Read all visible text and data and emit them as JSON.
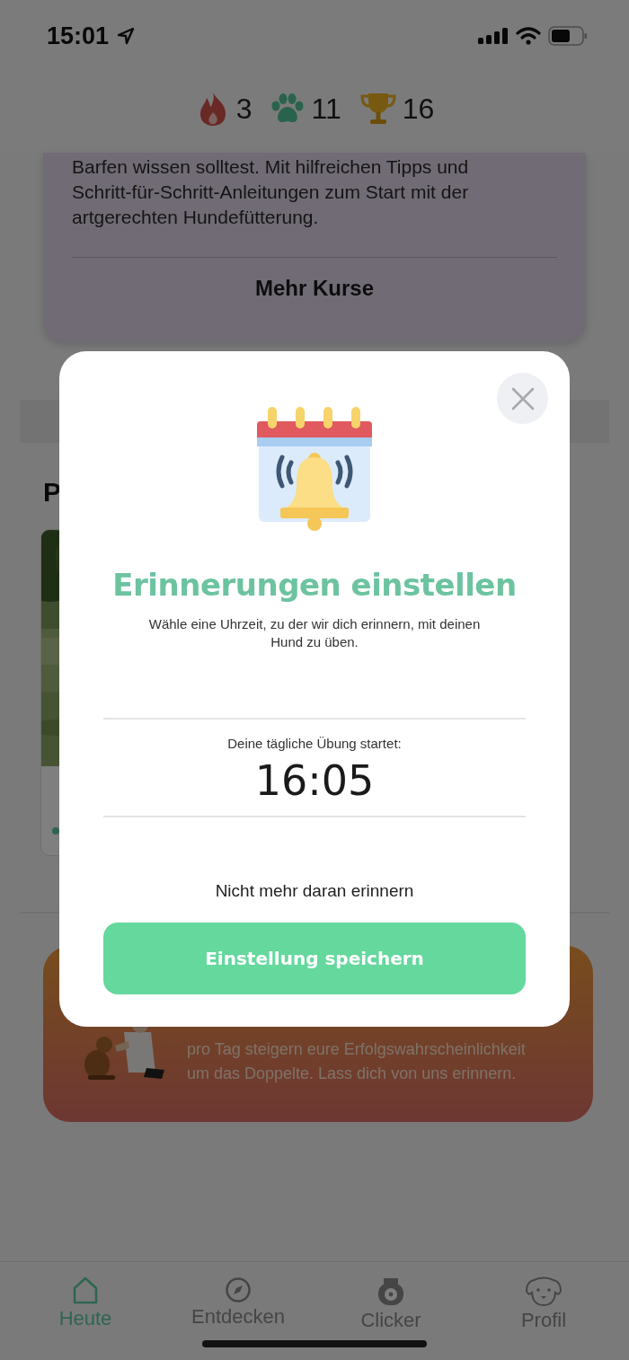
{
  "status_bar": {
    "time": "15:01"
  },
  "stats": [
    {
      "kind": "streak",
      "value": "3"
    },
    {
      "kind": "paws",
      "value": "11"
    },
    {
      "kind": "trophy",
      "value": "16"
    }
  ],
  "course_card": {
    "text": "Barfen wissen solltest. Mit hilfreichen Tipps und\nSchritt-für-Schritt-Anleitungen zum Start mit der\nartgerechten Hundefütterung.",
    "link": "Mehr Kurse"
  },
  "section": {
    "heading": "P"
  },
  "banner": {
    "text": "pro Tag steigern eure Erfolgswahrscheinlichkeit\num das Doppelte. Lass dich von uns erinnern."
  },
  "modal": {
    "title": "Erinnerungen einstellen",
    "description": "Wähle eine Uhrzeit, zu der wir dich erinnern, mit deinen\nHund zu üben.",
    "time_label": "Deine tägliche Übung startet:",
    "time": "16:05",
    "dismiss_link": "Nicht mehr daran erinnern",
    "save_button": "Einstellung speichern"
  },
  "tab_bar": [
    {
      "kind": "home",
      "label": "Heute",
      "selected": true
    },
    {
      "kind": "compass",
      "label": "Entdecken",
      "selected": false
    },
    {
      "kind": "clicker",
      "label": "Clicker",
      "selected": false
    },
    {
      "kind": "dog",
      "label": "Profil",
      "selected": false
    }
  ]
}
